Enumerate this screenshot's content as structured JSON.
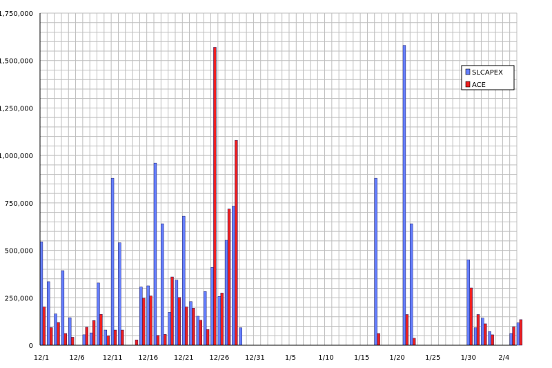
{
  "chart_data": {
    "type": "bar",
    "x_labels": [
      "12/1",
      "12/6",
      "12/11",
      "12/16",
      "12/21",
      "12/26",
      "12/31",
      "1/5",
      "1/10",
      "1/15",
      "1/20",
      "1/25",
      "1/30",
      "2/4"
    ],
    "dates": [
      "12/1",
      "12/2",
      "12/3",
      "12/4",
      "12/5",
      "12/6",
      "12/7",
      "12/8",
      "12/9",
      "12/10",
      "12/11",
      "12/12",
      "12/13",
      "12/14",
      "12/15",
      "12/16",
      "12/17",
      "12/18",
      "12/19",
      "12/20",
      "12/21",
      "12/22",
      "12/23",
      "12/24",
      "12/25",
      "12/26",
      "12/27",
      "12/28",
      "12/29",
      "12/30",
      "12/31",
      "1/1",
      "1/2",
      "1/3",
      "1/4",
      "1/5",
      "1/6",
      "1/7",
      "1/8",
      "1/9",
      "1/10",
      "1/11",
      "1/12",
      "1/13",
      "1/14",
      "1/15",
      "1/16",
      "1/17",
      "1/18",
      "1/19",
      "1/20",
      "1/21",
      "1/22",
      "1/23",
      "1/24",
      "1/25",
      "1/26",
      "1/27",
      "1/28",
      "1/29",
      "1/30",
      "1/31",
      "2/1",
      "2/2",
      "2/3",
      "2/4",
      "2/5"
    ],
    "y_ticks": [
      "0",
      "250,000",
      "500,000",
      "750,000",
      "1,000,000",
      "1,250,000",
      "1,500,000",
      "1,750,000"
    ],
    "ylim": [
      0,
      1750000
    ],
    "grid": true,
    "legend_position": "right",
    "series": [
      {
        "name": "SLCAPEX",
        "color": "#6680ff",
        "values": [
          545000,
          335000,
          165000,
          393000,
          145000,
          0,
          55000,
          65000,
          328000,
          80000,
          880000,
          540000,
          0,
          0,
          307000,
          313000,
          960000,
          640000,
          173000,
          343000,
          680000,
          230000,
          153000,
          283000,
          410000,
          257000,
          553000,
          733000,
          92000,
          0,
          0,
          0,
          0,
          0,
          0,
          0,
          0,
          0,
          0,
          0,
          0,
          0,
          0,
          0,
          0,
          0,
          0,
          880000,
          0,
          0,
          0,
          1580000,
          640000,
          0,
          0,
          0,
          0,
          0,
          0,
          0,
          450000,
          92000,
          143000,
          72000,
          0,
          0,
          62000,
          118000
        ]
      },
      {
        "name": "ACE",
        "color": "#ee2020",
        "values": [
          202000,
          93000,
          120000,
          62000,
          42000,
          0,
          95000,
          130000,
          163000,
          50000,
          80000,
          80000,
          0,
          28000,
          248000,
          260000,
          52000,
          57000,
          360000,
          252000,
          202000,
          195000,
          132000,
          83000,
          1570000,
          275000,
          718000,
          1080000,
          0,
          0,
          0,
          0,
          0,
          0,
          0,
          0,
          0,
          0,
          0,
          0,
          0,
          0,
          0,
          0,
          0,
          0,
          0,
          62000,
          0,
          0,
          0,
          162000,
          37000,
          0,
          0,
          0,
          0,
          0,
          0,
          0,
          302000,
          162000,
          113000,
          55000,
          0,
          0,
          97000,
          135000
        ]
      }
    ]
  }
}
